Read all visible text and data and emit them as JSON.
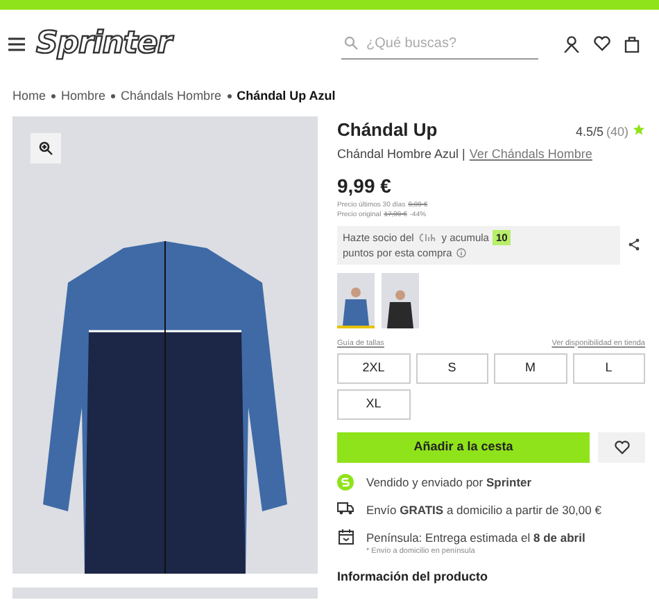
{
  "header": {
    "logo": "Sprinter",
    "search": {
      "placeholder": "¿Qué buscas?"
    }
  },
  "breadcrumb": [
    {
      "label": "Home",
      "current": false
    },
    {
      "label": "Hombre",
      "current": false
    },
    {
      "label": "Chándals Hombre",
      "current": false
    },
    {
      "label": "Chándal Up Azul",
      "current": true
    }
  ],
  "product": {
    "title": "Chándal Up",
    "rating": "4.5/5",
    "reviews": "(40)",
    "subtitle": "Chándal Hombre Azul |",
    "category_link": "Ver Chándals Hombre",
    "price": "9,99 €",
    "price_history": [
      {
        "label": "Precio últimos 30 días",
        "value": "9,99 €"
      },
      {
        "label": "Precio original",
        "value": "17,99 €",
        "discount": "-44%"
      }
    ],
    "promo": {
      "start": "Hazte socio del",
      "middle": "y acumula",
      "points": "10",
      "end": "puntos por esta compra"
    },
    "thumbnails": [
      {
        "kind": "blue",
        "selected": true
      },
      {
        "kind": "black",
        "selected": false
      }
    ],
    "size_guide": "Guía de tallas",
    "store_link": "Ver disponibilidad en tienda",
    "sizes": [
      {
        "label": "2XL",
        "selected": false
      },
      {
        "label": "S",
        "selected": false
      },
      {
        "label": "M",
        "selected": false
      },
      {
        "label": "L",
        "selected": false
      },
      {
        "label": "XL",
        "selected": false
      }
    ],
    "add_to_cart": "Añadir a la cesta",
    "info": [
      {
        "kind": "seller",
        "text": "Vendido y enviado por **Sprinter**"
      },
      {
        "kind": "shipping",
        "text": "Envío **GRATIS** a domicilio a partir de 30,00 €"
      },
      {
        "kind": "delivery",
        "text": "Península: Entrega estimada el **8 de abril**",
        "note": "* Envío a domicilio en península"
      }
    ]
  },
  "section_title": "Información del producto"
}
